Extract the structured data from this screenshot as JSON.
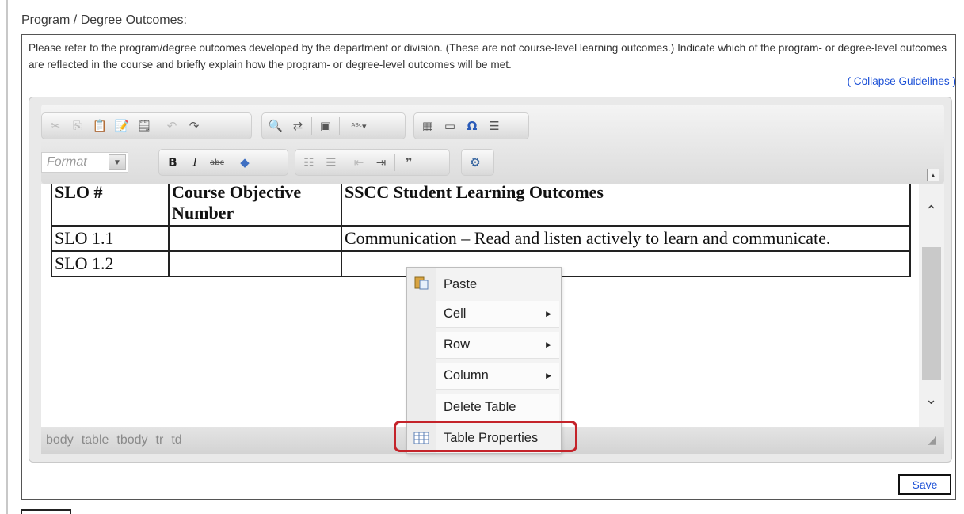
{
  "section": {
    "title": "Program / Degree Outcomes:",
    "guidelines": "Please refer to the program/degree outcomes developed by the department or division. (These are not course-level learning outcomes.) Indicate which of the program- or degree-level outcomes are reflected in the course and briefly explain how the program- or degree-level outcomes will be met.",
    "collapse_link": "( Collapse Guidelines )"
  },
  "toolbar": {
    "row1": [
      "cut-icon",
      "copy-icon",
      "paste-icon",
      "paste-text-icon",
      "paste-word-icon",
      "undo-icon",
      "redo-icon",
      "find-icon",
      "replace-icon",
      "select-all-icon",
      "spellcheck-icon",
      "table-icon",
      "horizontal-rule-icon",
      "special-char-icon",
      "page-break-icon"
    ],
    "format_placeholder": "Format",
    "row2": [
      "bold-icon",
      "italic-icon",
      "strike-icon",
      "remove-format-icon",
      "numbered-list-icon",
      "bulleted-list-icon",
      "outdent-icon",
      "indent-icon",
      "blockquote-icon",
      "maximize-icon"
    ]
  },
  "table": {
    "headers": [
      "SLO #",
      "Course Objective Number",
      "SSCC Student Learning Outcomes"
    ],
    "rows": [
      [
        "SLO 1.1",
        "",
        "Communication – Read and listen actively to learn and communicate."
      ],
      [
        "SLO 1.2",
        "",
        ""
      ]
    ]
  },
  "statusbar": {
    "path": [
      "body",
      "table",
      "tbody",
      "tr",
      "td"
    ]
  },
  "context_menu": {
    "items": [
      {
        "label": "Paste",
        "icon": "paste-icon",
        "submenu": false
      },
      {
        "label": "Cell",
        "submenu": true
      },
      {
        "label": "Row",
        "submenu": true
      },
      {
        "label": "Column",
        "submenu": true
      },
      {
        "label": "Delete Table",
        "submenu": false
      },
      {
        "label": "Table Properties",
        "icon": "table-properties-icon",
        "submenu": false
      }
    ],
    "highlighted": "Table Properties",
    "highlight_color": "#c4232a"
  },
  "save_label": "Save"
}
